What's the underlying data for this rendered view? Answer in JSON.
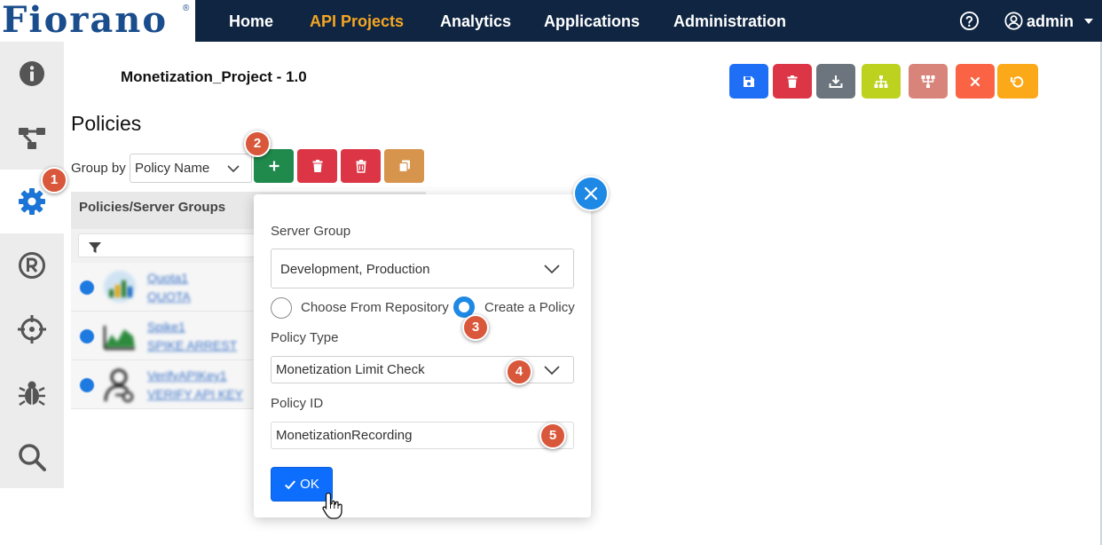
{
  "app": {
    "logo_text": "Fiorano",
    "logo_mark": "®"
  },
  "nav": {
    "items": [
      {
        "label": "Home"
      },
      {
        "label": "API Projects"
      },
      {
        "label": "Analytics"
      },
      {
        "label": "Applications"
      },
      {
        "label": "Administration"
      }
    ],
    "active_color": "#f5a623",
    "user_label": "admin"
  },
  "sidebar": {
    "items": [
      {
        "icon": "info-icon"
      },
      {
        "icon": "flow-icon"
      },
      {
        "icon": "gear-icon",
        "active": true
      },
      {
        "icon": "registered-icon"
      },
      {
        "icon": "crosshair-icon"
      },
      {
        "icon": "bug-icon"
      },
      {
        "icon": "search-icon"
      }
    ]
  },
  "project": {
    "title": "Monetization_Project - 1.0"
  },
  "toolbar": {
    "buttons": [
      {
        "icon": "save-icon",
        "color": "#1e6ff5"
      },
      {
        "icon": "trash-icon",
        "color": "#dc3545"
      },
      {
        "icon": "download-icon",
        "color": "#6c757d"
      },
      {
        "icon": "hierarchy-icon",
        "color": "#bcd21e"
      },
      {
        "icon": "org-chart-icon",
        "color": "#d9847a"
      },
      {
        "icon": "close-icon",
        "color": "#fa6445"
      },
      {
        "icon": "undo-icon",
        "color": "#fba919"
      }
    ]
  },
  "policies": {
    "heading": "Policies",
    "group_by_label": "Group by",
    "group_by_value": "Policy Name",
    "actions": [
      {
        "icon": "plus-icon",
        "color": "#1f8a4c"
      },
      {
        "icon": "trash-icon",
        "color": "#dc3545"
      },
      {
        "icon": "trash-icon",
        "color": "#dc3545"
      },
      {
        "icon": "copy-icon",
        "color": "#d6944d"
      }
    ],
    "table": {
      "header": "Policies/Server Groups",
      "rows": [
        {
          "name": "Quota1",
          "type": "QUOTA"
        },
        {
          "name": "Spike1",
          "type": "SPIKE ARREST"
        },
        {
          "name": "VerifyAPIKey1",
          "type": "VERIFY API KEY"
        }
      ]
    }
  },
  "modal": {
    "server_group_label": "Server Group",
    "server_group_value": "Development, Production",
    "radio_choose_label": "Choose From Repository",
    "radio_create_label": "Create a Policy",
    "selected_option": "create",
    "policy_type_label": "Policy Type",
    "policy_type_value": "Monetization Limit Check",
    "policy_id_label": "Policy ID",
    "policy_id_value": "MonetizationRecording",
    "ok_label": "OK"
  },
  "badges": [
    "1",
    "2",
    "3",
    "4",
    "5"
  ]
}
